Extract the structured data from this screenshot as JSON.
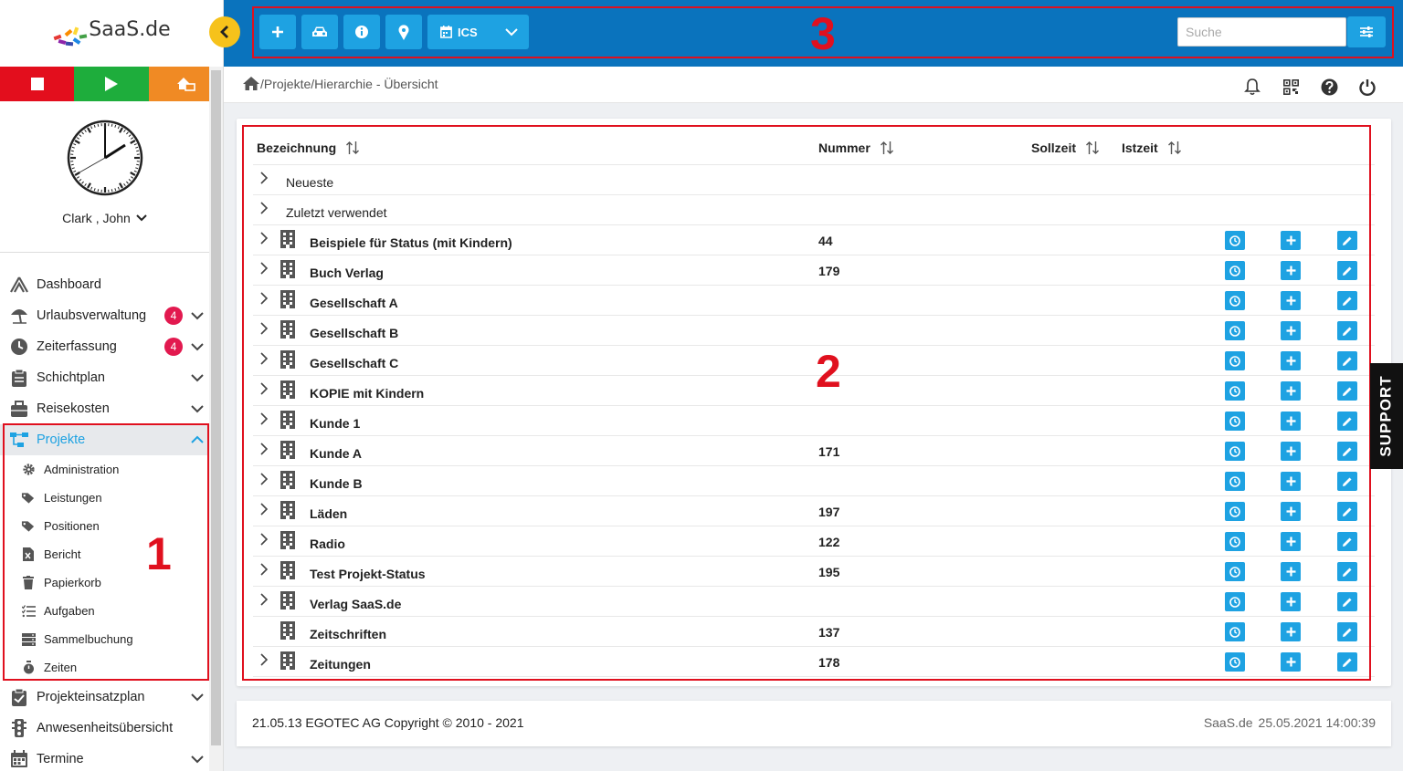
{
  "app": {
    "logo_text": "SaaS.de"
  },
  "user": {
    "name": "Clark , John"
  },
  "sidebar": {
    "items": [
      {
        "label": "Dashboard",
        "icon": "dashboard-icon"
      },
      {
        "label": "Urlaubsverwaltung",
        "icon": "beach-umbrella-icon",
        "badge": "4"
      },
      {
        "label": "Zeiterfassung",
        "icon": "clock-icon",
        "badge": "4"
      },
      {
        "label": "Schichtplan",
        "icon": "clipboard-icon"
      },
      {
        "label": "Reisekosten",
        "icon": "suitcase-icon"
      },
      {
        "label": "Projekte",
        "icon": "sitemap-icon"
      },
      {
        "label": "Projekteinsatzplan",
        "icon": "clipboard-check-icon"
      },
      {
        "label": "Anwesenheitsübersicht",
        "icon": "traffic-light-icon"
      },
      {
        "label": "Termine",
        "icon": "calendar-icon"
      }
    ],
    "sub_items": [
      {
        "label": "Administration",
        "icon": "gear-icon"
      },
      {
        "label": "Leistungen",
        "icon": "tags-icon"
      },
      {
        "label": "Positionen",
        "icon": "tags-icon"
      },
      {
        "label": "Bericht",
        "icon": "excel-file-icon"
      },
      {
        "label": "Papierkorb",
        "icon": "trash-icon"
      },
      {
        "label": "Aufgaben",
        "icon": "task-list-icon"
      },
      {
        "label": "Sammelbuchung",
        "icon": "server-icon"
      },
      {
        "label": "Zeiten",
        "icon": "stopwatch-icon"
      }
    ]
  },
  "toolbar": {
    "ics_label": "ICS",
    "search_placeholder": "Suche"
  },
  "breadcrumb": {
    "path": "/Projekte/Hierarchie - Übersicht"
  },
  "table": {
    "headers": {
      "name": "Bezeichnung",
      "number": "Nummer",
      "target": "Sollzeit",
      "actual": "Istzeit"
    },
    "groups": [
      {
        "label": "Neueste"
      },
      {
        "label": "Zuletzt verwendet"
      }
    ],
    "rows": [
      {
        "name": "Beispiele für Status (mit Kindern)",
        "number": "44"
      },
      {
        "name": "Buch Verlag",
        "number": "179"
      },
      {
        "name": "Gesellschaft A",
        "number": ""
      },
      {
        "name": "Gesellschaft B",
        "number": ""
      },
      {
        "name": "Gesellschaft C",
        "number": ""
      },
      {
        "name": "KOPIE mit Kindern",
        "number": ""
      },
      {
        "name": "Kunde 1",
        "number": ""
      },
      {
        "name": "Kunde A",
        "number": "171"
      },
      {
        "name": "Kunde B",
        "number": ""
      },
      {
        "name": "Läden",
        "number": "197"
      },
      {
        "name": "Radio",
        "number": "122"
      },
      {
        "name": "Test Projekt-Status",
        "number": "195"
      },
      {
        "name": "Verlag SaaS.de",
        "number": ""
      },
      {
        "name": "Zeitschriften",
        "number": "137",
        "no_expander": true
      },
      {
        "name": "Zeitungen",
        "number": "178"
      }
    ]
  },
  "annotations": {
    "one": "1",
    "two": "2",
    "three": "3"
  },
  "support": {
    "label": "SUPPORT"
  },
  "footer": {
    "left": "21.05.13 EGOTEC AG Copyright © 2010 - 2021",
    "brand": "SaaS.de",
    "datetime": "25.05.2021 14:00:39"
  },
  "colors": {
    "topbar": "#0a73bd",
    "button": "#1ea2e2",
    "stop": "#e30e1d",
    "play": "#1ead3c",
    "home": "#f08a24",
    "badge": "#e2194f",
    "annotation": "#e0101e",
    "collapse": "#f6c21b"
  }
}
